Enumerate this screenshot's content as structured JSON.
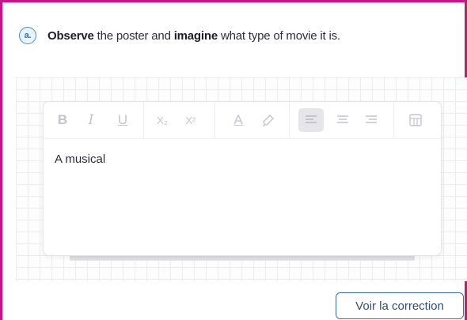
{
  "question": {
    "badge": "a.",
    "word1": "Observe",
    "text1": " the poster and ",
    "word2": "imagine",
    "text2": " what type of movie it is."
  },
  "toolbar": {
    "bold": "B",
    "italic": "I",
    "underline": "U",
    "subscript": "X₂",
    "superscript": "X²",
    "font_color": "A"
  },
  "editor": {
    "content": "A musical"
  },
  "actions": {
    "show_correction": "Voir la correction"
  },
  "colors": {
    "frame": "#c71585",
    "accent": "#3b8fd4",
    "button_border": "#3b6ea5"
  },
  "icons": [
    "highlighter-icon",
    "align-left-icon",
    "align-center-icon",
    "align-right-icon",
    "table-icon"
  ]
}
